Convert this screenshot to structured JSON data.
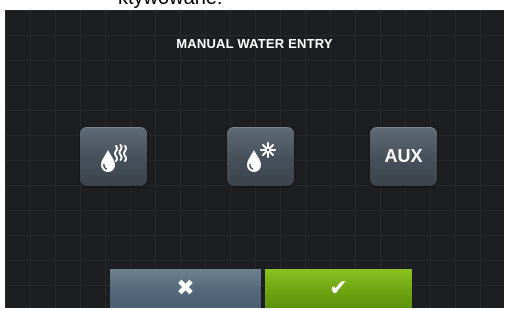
{
  "document": {
    "fragment_text": "ktywowane:"
  },
  "screen": {
    "title": "MANUAL WATER ENTRY"
  },
  "buttons": {
    "hot_water": {
      "icon": "hot-water-drop-icon"
    },
    "cold_water": {
      "icon": "cold-water-drop-icon"
    },
    "aux": {
      "label": "AUX"
    },
    "cancel": {
      "icon": "close-icon",
      "glyph": "✖",
      "color": "#5a6e80"
    },
    "confirm": {
      "icon": "checkmark-icon",
      "glyph": "✔",
      "color": "#7ab51a"
    }
  },
  "colors": {
    "screen_background": "#1d1e21",
    "button_gray": "#4b555f"
  }
}
